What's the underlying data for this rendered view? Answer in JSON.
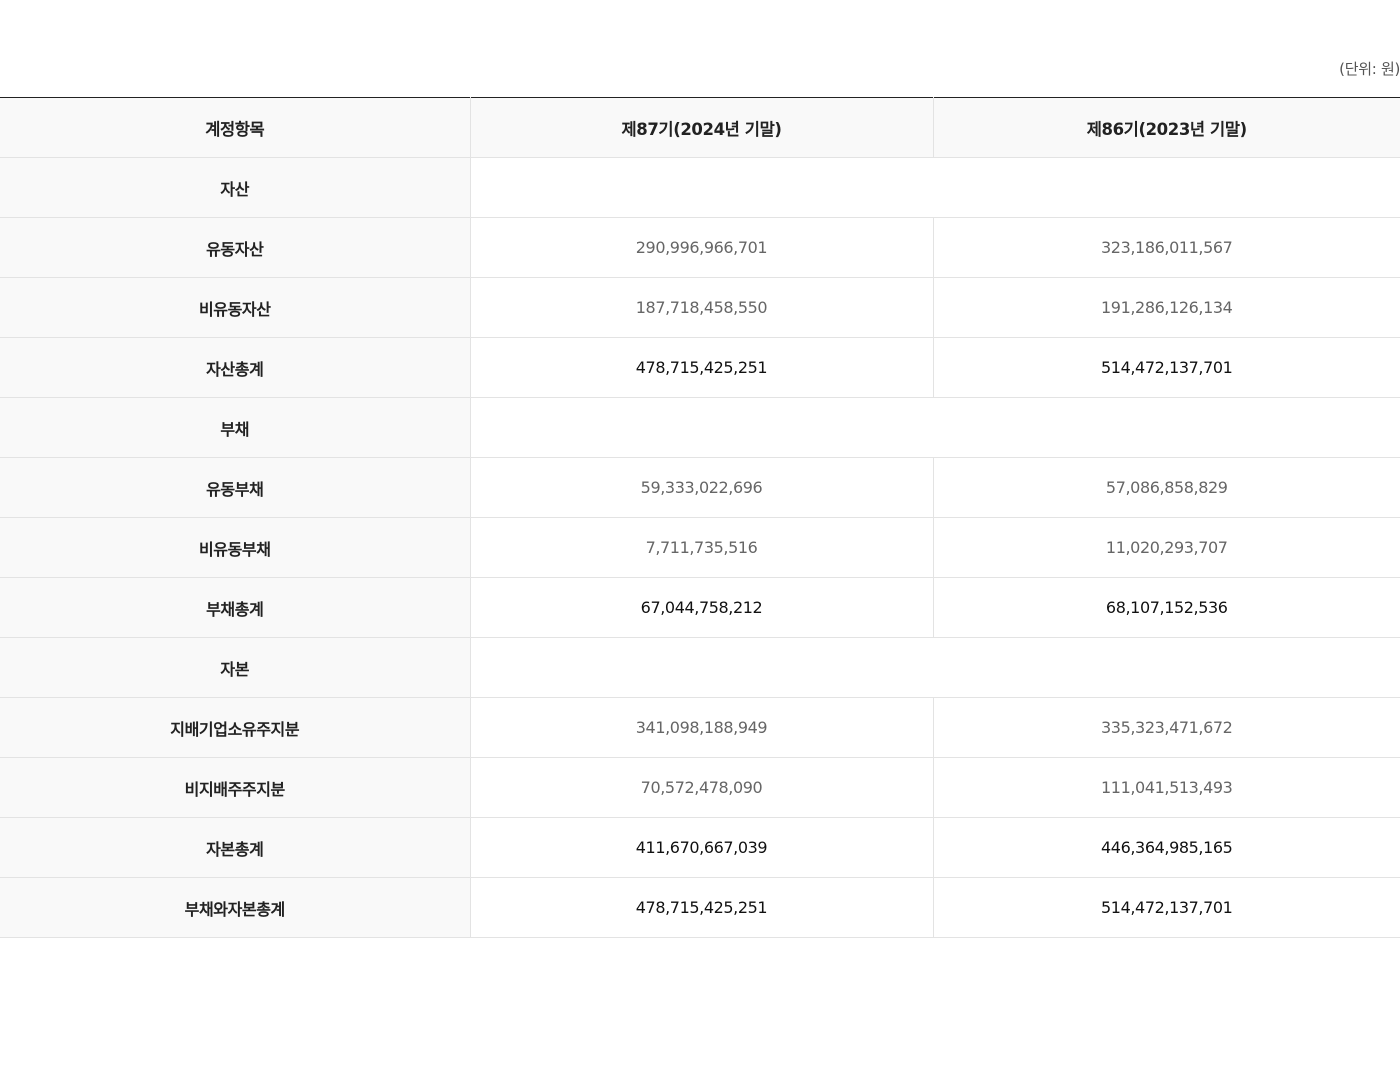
{
  "unit_note": "(단위: 원)",
  "headers": {
    "account": "계정항목",
    "period_87": "제87기(2024년 기말)",
    "period_86": "제86기(2023년 기말)"
  },
  "rows": [
    {
      "label": "자산",
      "type": "section"
    },
    {
      "label": "유동자산",
      "type": "item",
      "v87": "290,996,966,701",
      "v86": "323,186,011,567"
    },
    {
      "label": "비유동자산",
      "type": "item",
      "v87": "187,718,458,550",
      "v86": "191,286,126,134"
    },
    {
      "label": "자산총계",
      "type": "total",
      "v87": "478,715,425,251",
      "v86": "514,472,137,701"
    },
    {
      "label": "부채",
      "type": "section"
    },
    {
      "label": "유동부채",
      "type": "item",
      "v87": "59,333,022,696",
      "v86": "57,086,858,829"
    },
    {
      "label": "비유동부채",
      "type": "item",
      "v87": "7,711,735,516",
      "v86": "11,020,293,707"
    },
    {
      "label": "부채총계",
      "type": "total",
      "v87": "67,044,758,212",
      "v86": "68,107,152,536"
    },
    {
      "label": "자본",
      "type": "section"
    },
    {
      "label": "지배기업소유주지분",
      "type": "item",
      "v87": "341,098,188,949",
      "v86": "335,323,471,672"
    },
    {
      "label": "비지배주주지분",
      "type": "item",
      "v87": "70,572,478,090",
      "v86": "111,041,513,493"
    },
    {
      "label": "자본총계",
      "type": "total",
      "v87": "411,670,667,039",
      "v86": "446,364,985,165"
    },
    {
      "label": "부채와자본총계",
      "type": "total",
      "v87": "478,715,425,251",
      "v86": "514,472,137,701"
    }
  ]
}
